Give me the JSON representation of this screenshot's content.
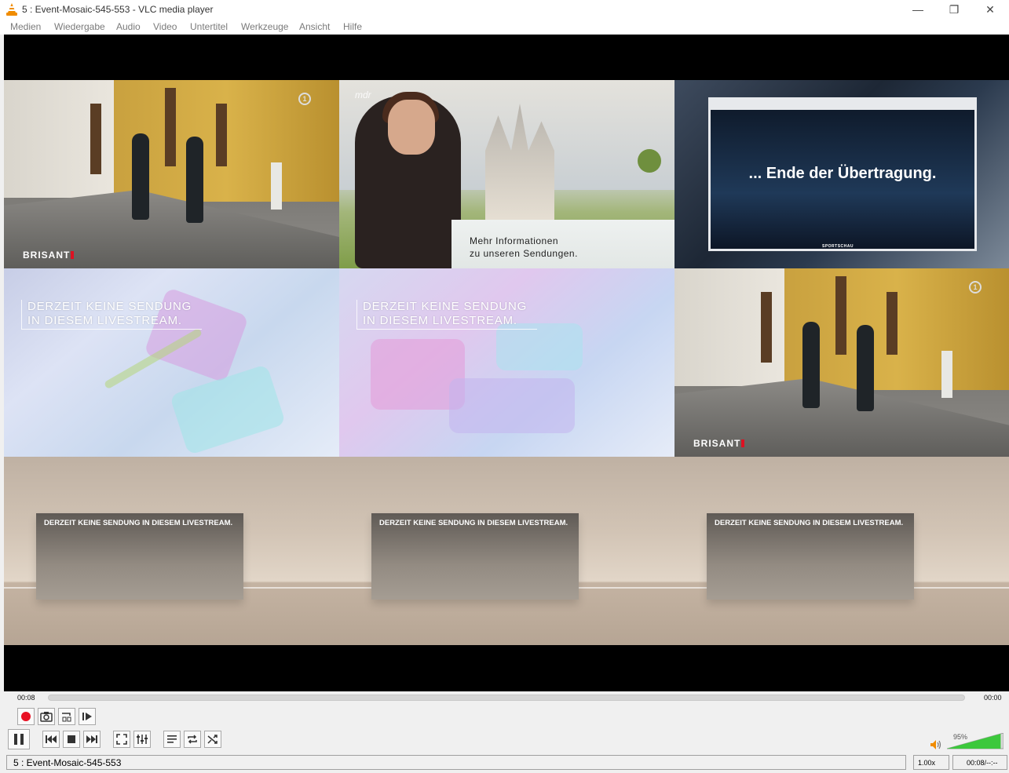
{
  "window": {
    "title": "5 : Event-Mosaic-545-553 - VLC media player",
    "min_glyph": "—",
    "max_glyph": "❐",
    "close_glyph": "✕"
  },
  "menu": {
    "items": [
      "Medien",
      "Wiedergabe",
      "Audio",
      "Video",
      "Untertitel",
      "Werkzeuge",
      "Ansicht",
      "Hilfe"
    ]
  },
  "tiles": {
    "brisant_logo": "BRISANT",
    "ard_one": "1",
    "mdr_logo": "mdr",
    "mdr_line1": "Mehr Informationen",
    "mdr_line2": "zu unseren Sendungen.",
    "sport_text": "... Ende der Übertragung.",
    "sport_logo": "SPORTSCHAU",
    "livestream_line1": "DERZEIT KEINE SENDUNG",
    "livestream_line2": "IN DIESEM LIVESTREAM.",
    "studio_text": "DERZEIT KEINE SENDUNG IN DIESEM LIVESTREAM."
  },
  "playback": {
    "elapsed": "00:08",
    "total": "00:00",
    "position_fraction": 0.0
  },
  "volume": {
    "label": "95%",
    "level_fraction": 0.95,
    "accent": "#3cc83c"
  },
  "status": {
    "media": "5 : Event-Mosaic-545-553",
    "speed": "1.00x",
    "time": "00:08/--:--"
  },
  "colors": {
    "record": "#e81123",
    "vlc_orange": "#f08c00"
  }
}
